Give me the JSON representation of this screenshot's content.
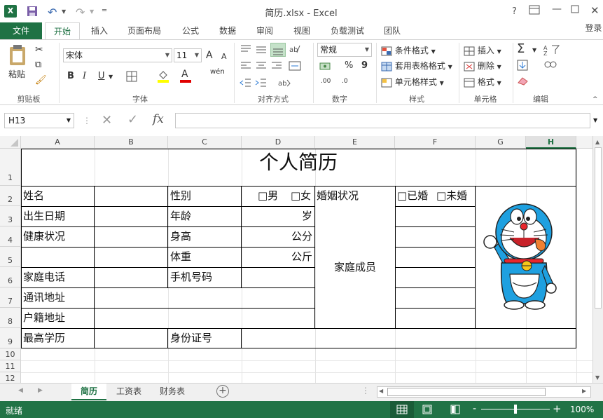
{
  "window": {
    "title": "简历.xlsx - Excel",
    "help": "?",
    "login": "登录"
  },
  "ribbon_tabs": [
    "文件",
    "开始",
    "插入",
    "页面布局",
    "公式",
    "数据",
    "审阅",
    "视图",
    "负载测试",
    "团队"
  ],
  "ribbon": {
    "paste": "粘贴",
    "clipboard": "剪贴板",
    "font_name": "宋体",
    "font_size": "11",
    "font_group": "字体",
    "bold": "B",
    "italic": "I",
    "underline": "U",
    "wen": "wén",
    "align_group": "对齐方式",
    "number_format": "常规",
    "number_group": "数字",
    "percent": "%",
    "comma": "9",
    "dec_inc": ".00",
    "dec_dec": ".0",
    "conditional": "条件格式",
    "table_format": "套用表格格式",
    "cell_style": "单元格样式",
    "style_group": "样式",
    "insert": "插入",
    "delete": "删除",
    "format": "格式",
    "cells_group": "单元格",
    "edit_group": "编辑",
    "font_inc": "A",
    "font_dec": "A",
    "font_color": "A"
  },
  "formula_bar": {
    "name_box": "H13",
    "fx": "fx",
    "content": ""
  },
  "columns": [
    "A",
    "B",
    "C",
    "D",
    "E",
    "F",
    "G",
    "H"
  ],
  "rows": [
    "1",
    "2",
    "3",
    "4",
    "5",
    "6",
    "7",
    "8",
    "9",
    "10",
    "11",
    "12"
  ],
  "sheet": {
    "title": "个人简历",
    "name": "姓名",
    "gender": "性别",
    "male": "□男",
    "female": "□女",
    "marital": "婚姻状况",
    "married": "□已婚",
    "single": "□未婚",
    "birth": "出生日期",
    "age": "年龄",
    "age_unit": "岁",
    "health": "健康状况",
    "height": "身高",
    "height_unit": "公分",
    "weight": "体重",
    "weight_unit": "公斤",
    "family": "家庭成员",
    "home_phone": "家庭电话",
    "mobile": "手机号码",
    "address": "通讯地址",
    "hukou": "户籍地址",
    "education": "最高学历",
    "id_number": "身份证号"
  },
  "sheet_tabs": [
    "简历",
    "工资表",
    "财务表"
  ],
  "status": {
    "ready": "就绪",
    "zoom": "100%",
    "minus": "-",
    "plus": "+"
  },
  "colors": {
    "brand": "#217346",
    "tab_file": "#1f7244"
  }
}
